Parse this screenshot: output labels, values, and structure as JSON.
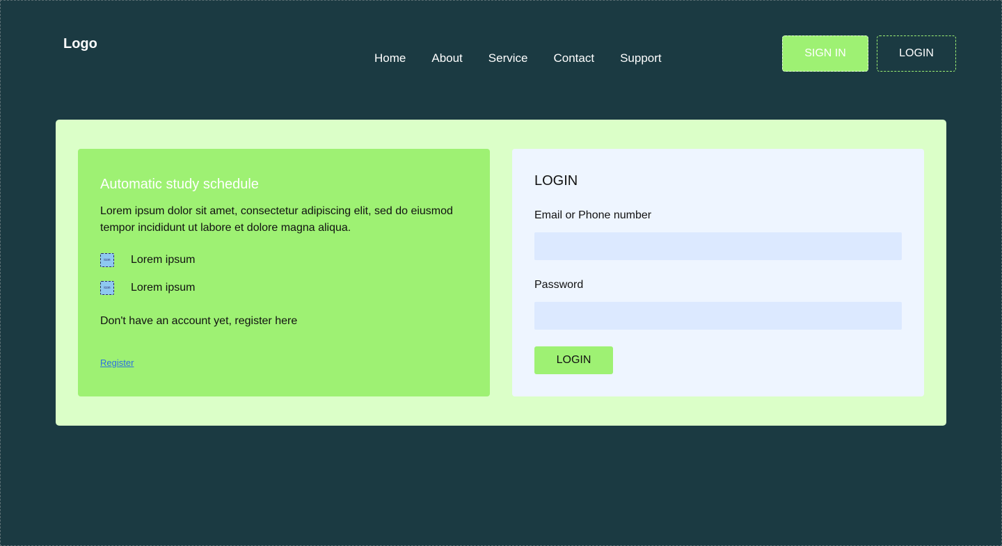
{
  "header": {
    "logo": "Logo",
    "nav": [
      "Home",
      "About",
      "Service",
      "Contact",
      "Support"
    ],
    "signin_label": "SIGN IN",
    "login_label": "LOGIN"
  },
  "promo": {
    "title": "Automatic study schedule",
    "description": "Lorem ipsum dolor sit amet, consectetur adipiscing elit, sed do eiusmod tempor incididunt ut labore et dolore magna aliqua.",
    "features": [
      {
        "icon_text": "icon",
        "label": "Lorem ipsum"
      },
      {
        "icon_text": "icon",
        "label": "Lorem ipsum"
      }
    ],
    "register_prompt": "Don't have an account yet, register here",
    "register_link": "Register"
  },
  "login_form": {
    "title": "LOGIN",
    "email_label": "Email or Phone number",
    "email_value": "",
    "password_label": "Password",
    "password_value": "",
    "submit_label": "LOGIN"
  },
  "colors": {
    "background": "#1b3a42",
    "accent": "#9ef173",
    "card": "#dbffc8",
    "form_panel": "#eef5ff",
    "input": "#dce9ff",
    "link": "#2b6fe0"
  }
}
